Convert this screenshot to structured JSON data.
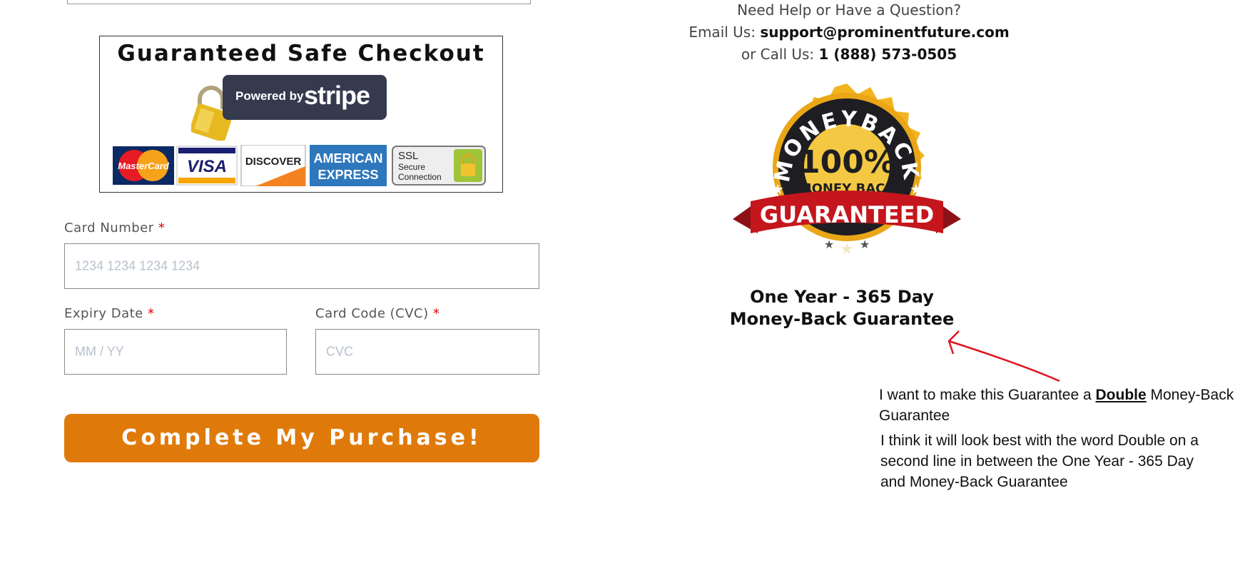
{
  "checkout_badge": {
    "title": "Guaranteed Safe Checkout",
    "powered_by": "Powered by",
    "stripe": "stripe",
    "card_logos": [
      "MasterCard",
      "VISA",
      "DISCOVER",
      "AMERICAN",
      "EXPRESS",
      "SSL",
      "Secure",
      "Connection"
    ]
  },
  "form": {
    "card_number_label": "Card Number",
    "card_number_placeholder": "1234 1234 1234 1234",
    "expiry_label": "Expiry Date",
    "expiry_placeholder": "MM / YY",
    "cvc_label": "Card Code (CVC)",
    "cvc_placeholder": "CVC",
    "required_mark": "*",
    "submit_label": "Complete My Purchase!"
  },
  "help": {
    "question": "Need Help or Have a Question?",
    "email_prefix": "Email Us: ",
    "email": "support@prominentfuture.com",
    "phone_prefix": "or Call Us: ",
    "phone": "1 (888) 573-0505"
  },
  "seal": {
    "arc_text": "MONEYBACK",
    "percent": "100%",
    "money_back": "MONEY BACK",
    "guaranteed": "GUARANTEED"
  },
  "guarantee": {
    "line1": "One Year - 365 Day",
    "line2": "Money-Back Guarantee"
  },
  "annotation": {
    "p1_before": "I want to make this Guarantee a ",
    "p1_emph": "Double",
    "p1_after": " Money-Back Guarantee",
    "p2": "I think it will look best with the word Double on a second line in between the One Year - 365 Day and Money-Back Guarantee"
  },
  "colors": {
    "button": "#df7a0a",
    "required": "#dd0000",
    "annotation_arrow": "#e0141e"
  }
}
